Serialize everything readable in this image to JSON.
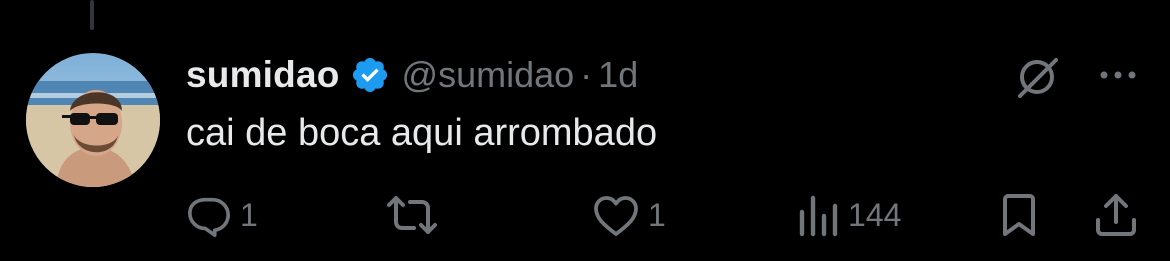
{
  "tweet": {
    "display_name": "sumidao",
    "handle": "@sumidao",
    "separator": "·",
    "time": "1d",
    "text": "cai de boca aqui arrombado",
    "verified": true
  },
  "actions": {
    "reply_count": "1",
    "like_count": "1",
    "views_count": "144"
  },
  "icons": {
    "verified": "verified-badge-icon",
    "grok": "grok-icon",
    "more": "more-icon",
    "reply": "reply-icon",
    "retweet": "retweet-icon",
    "like": "heart-icon",
    "views": "views-icon",
    "bookmark": "bookmark-icon",
    "share": "share-icon"
  },
  "colors": {
    "background": "#000000",
    "text_primary": "#e7e9ea",
    "text_secondary": "#71767b",
    "verified_blue": "#1d9bf0"
  }
}
